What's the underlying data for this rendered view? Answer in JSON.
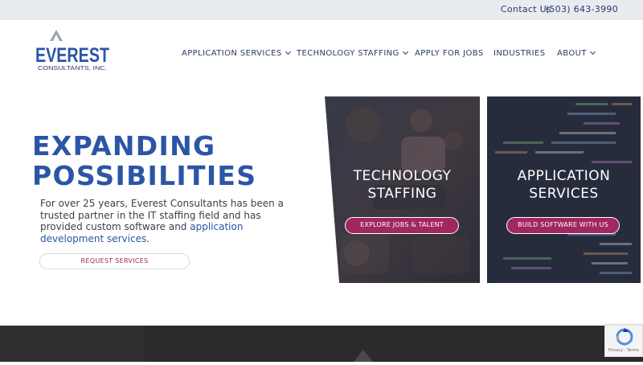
{
  "topbar": {
    "contact": "Contact Us",
    "phone": "(503) 643-3990"
  },
  "logo": {
    "brand": "EVEREST",
    "tagline": "CONSULTANTS, INC."
  },
  "nav": [
    {
      "label": "APPLICATION SERVICES",
      "dropdown": true
    },
    {
      "label": "TECHNOLOGY STAFFING",
      "dropdown": true
    },
    {
      "label": "APPLY FOR JOBS",
      "dropdown": false
    },
    {
      "label": "INDUSTRIES",
      "dropdown": false
    },
    {
      "label": "ABOUT",
      "dropdown": true
    }
  ],
  "hero": {
    "headline_line1": "EXPANDING",
    "headline_line2": "POSSIBILITIES",
    "intro_text": "For over 25 years, Everest Consultants has been a trusted partner in the IT staffing field and has provided custom software and ",
    "intro_link": "application development services",
    "intro_end": ".",
    "button": "REQUEST SERVICES"
  },
  "panels": {
    "staffing": {
      "title_line1": "TECHNOLOGY",
      "title_line2": "STAFFING",
      "button": "EXPLORE JOBS & TALENT"
    },
    "services": {
      "title_line1": "APPLICATION",
      "title_line2": "SERVICES",
      "button": "BUILD SOFTWARE WITH US"
    }
  },
  "recaptcha": {
    "text": "Privacy - Terms"
  },
  "colors": {
    "brand_blue": "#2b55a6",
    "accent": "#a0275f",
    "nav": "#2a3a6a"
  }
}
